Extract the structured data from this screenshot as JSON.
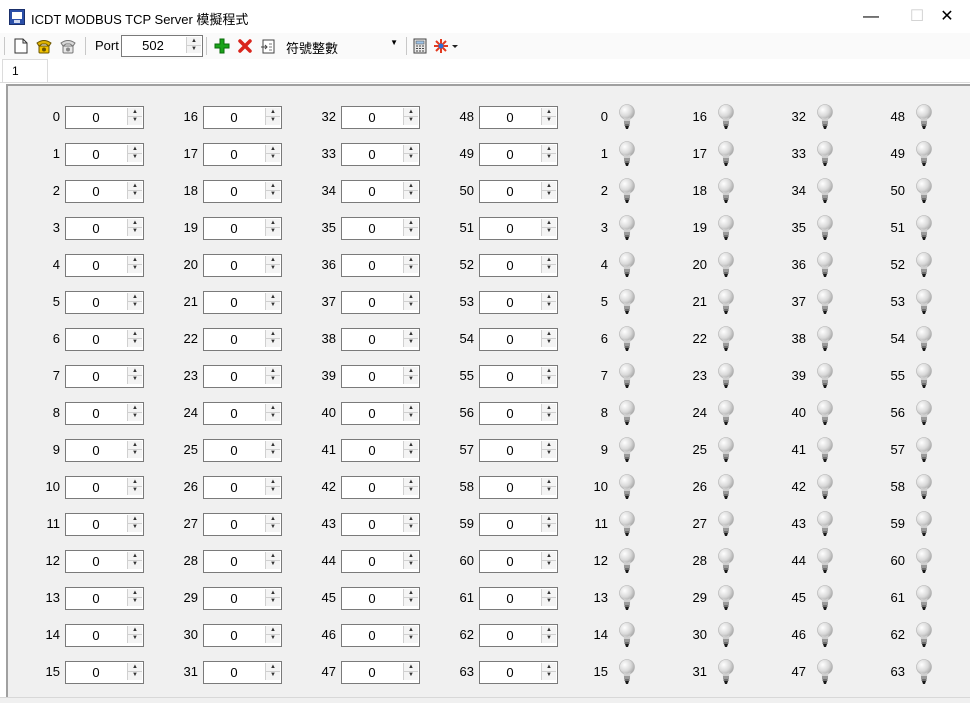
{
  "window": {
    "title": "ICDT MODBUS TCP Server 模擬程式",
    "minimize_glyph": "—",
    "maximize_glyph": "☐",
    "close_glyph": "✕"
  },
  "toolbar": {
    "icons": [
      "new-document-icon",
      "connect-phone-icon",
      "disconnect-phone-icon",
      "add-icon",
      "delete-icon",
      "export-icon",
      "calculator-icon",
      "star-settings-icon"
    ],
    "port_label": "Port",
    "port_value": "502",
    "data_format": "符號整數",
    "colors": {
      "add": "#1aa31a",
      "delete": "#d9251c"
    }
  },
  "tabs": [
    {
      "label": "1"
    }
  ],
  "registers": {
    "columns": [
      [
        0,
        1,
        2,
        3,
        4,
        5,
        6,
        7,
        8,
        9,
        10,
        11,
        12,
        13,
        14,
        15
      ],
      [
        16,
        17,
        18,
        19,
        20,
        21,
        22,
        23,
        24,
        25,
        26,
        27,
        28,
        29,
        30,
        31
      ],
      [
        32,
        33,
        34,
        35,
        36,
        37,
        38,
        39,
        40,
        41,
        42,
        43,
        44,
        45,
        46,
        47
      ],
      [
        48,
        49,
        50,
        51,
        52,
        53,
        54,
        55,
        56,
        57,
        58,
        59,
        60,
        61,
        62,
        63
      ]
    ],
    "value": "0"
  },
  "coils": {
    "columns": [
      [
        0,
        1,
        2,
        3,
        4,
        5,
        6,
        7,
        8,
        9,
        10,
        11,
        12,
        13,
        14,
        15
      ],
      [
        16,
        17,
        18,
        19,
        20,
        21,
        22,
        23,
        24,
        25,
        26,
        27,
        28,
        29,
        30,
        31
      ],
      [
        32,
        33,
        34,
        35,
        36,
        37,
        38,
        39,
        40,
        41,
        42,
        43,
        44,
        45,
        46,
        47
      ],
      [
        48,
        49,
        50,
        51,
        52,
        53,
        54,
        55,
        56,
        57,
        58,
        59,
        60,
        61,
        62,
        63
      ]
    ],
    "state": "off",
    "icon": "light-bulb-off-icon"
  }
}
